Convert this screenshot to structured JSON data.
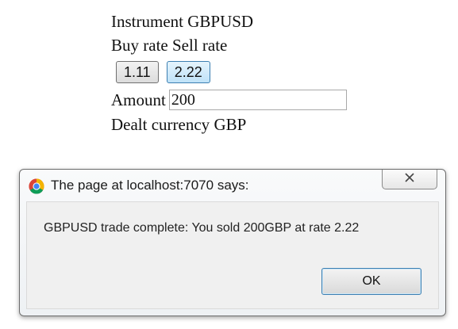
{
  "form": {
    "instrument_label": "Instrument",
    "instrument_value": "GBPUSD",
    "buy_rate_label": "Buy rate",
    "sell_rate_label": "Sell rate",
    "buy_rate_button": "1.11",
    "sell_rate_button": "2.22",
    "amount_label": "Amount",
    "amount_value": "200",
    "dealt_currency_label": "Dealt currency",
    "dealt_currency_value": "GBP"
  },
  "dialog": {
    "title": "The page at localhost:7070 says:",
    "message": "GBPUSD trade complete: You sold 200GBP at rate 2.22",
    "ok_label": "OK",
    "close_icon": "close-icon",
    "browser_icon": "chrome-icon"
  },
  "colors": {
    "active_button_border": "#3c7fb1",
    "active_button_fill": "#bfe2f8",
    "dialog_border": "#6d6d6d"
  }
}
